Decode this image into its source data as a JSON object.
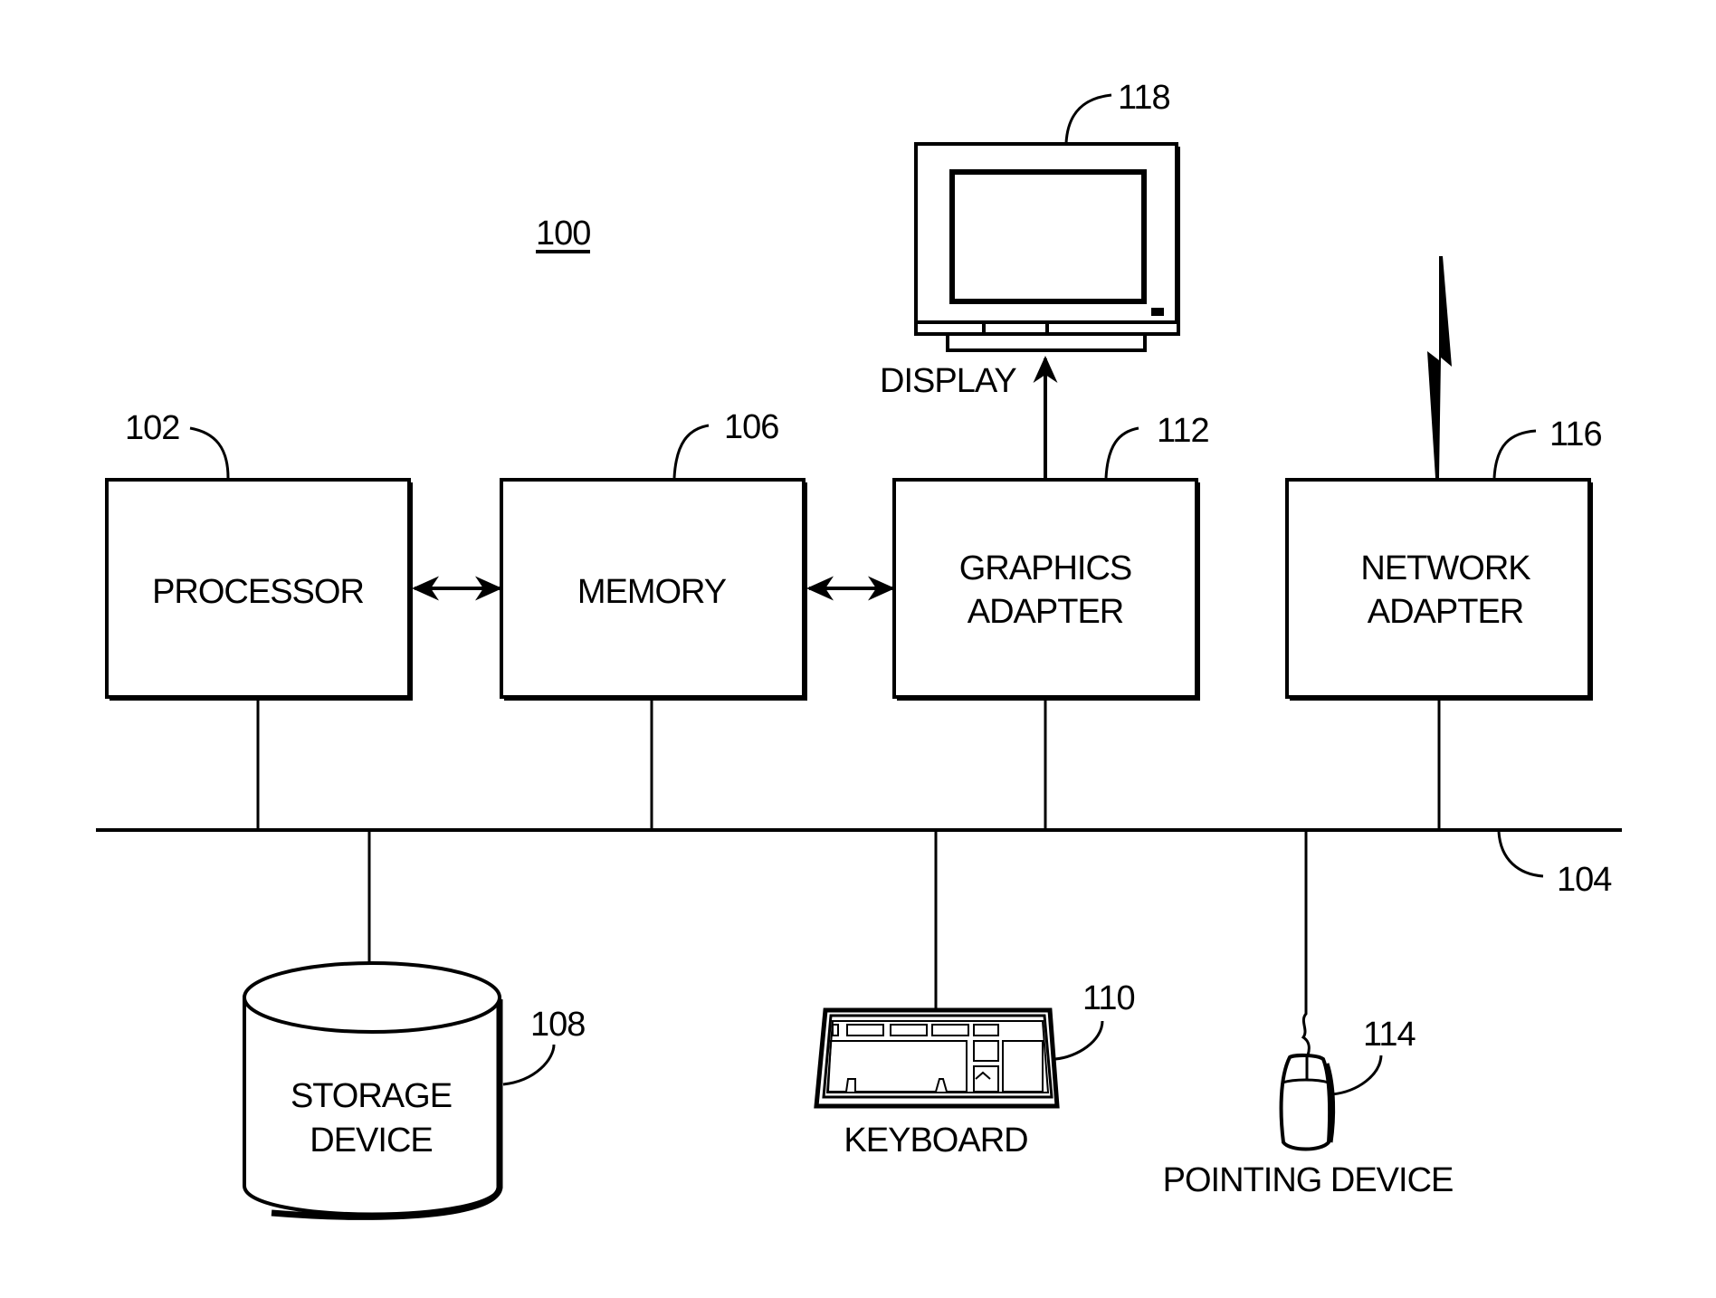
{
  "figure": {
    "figure_ref": "100",
    "bus_ref": "104"
  },
  "components": {
    "processor": {
      "ref": "102",
      "lines": [
        "PROCESSOR"
      ]
    },
    "memory": {
      "ref": "106",
      "lines": [
        "MEMORY"
      ]
    },
    "graphics_adapter": {
      "ref": "112",
      "lines": [
        "GRAPHICS",
        "ADAPTER"
      ]
    },
    "network_adapter": {
      "ref": "116",
      "lines": [
        "NETWORK",
        "ADAPTER"
      ]
    },
    "display": {
      "ref": "118",
      "label": "DISPLAY"
    },
    "storage_device": {
      "ref": "108",
      "lines": [
        "STORAGE",
        "DEVICE"
      ]
    },
    "keyboard": {
      "ref": "110",
      "label": "KEYBOARD"
    },
    "pointing_device": {
      "ref": "114",
      "label": "POINTING DEVICE"
    }
  },
  "connections": [
    {
      "from": "processor",
      "to": "memory",
      "type": "bidirectional-arrow"
    },
    {
      "from": "memory",
      "to": "graphics_adapter",
      "type": "bidirectional-arrow"
    },
    {
      "from": "graphics_adapter",
      "to": "display",
      "type": "arrow"
    },
    {
      "from": "network_adapter",
      "to": "network",
      "type": "wireless-link"
    },
    {
      "from": "processor",
      "to": "bus",
      "type": "line"
    },
    {
      "from": "memory",
      "to": "bus",
      "type": "line"
    },
    {
      "from": "graphics_adapter",
      "to": "bus",
      "type": "line"
    },
    {
      "from": "network_adapter",
      "to": "bus",
      "type": "line"
    },
    {
      "from": "storage_device",
      "to": "bus",
      "type": "line"
    },
    {
      "from": "keyboard",
      "to": "bus",
      "type": "line"
    },
    {
      "from": "pointing_device",
      "to": "bus",
      "type": "line"
    }
  ]
}
